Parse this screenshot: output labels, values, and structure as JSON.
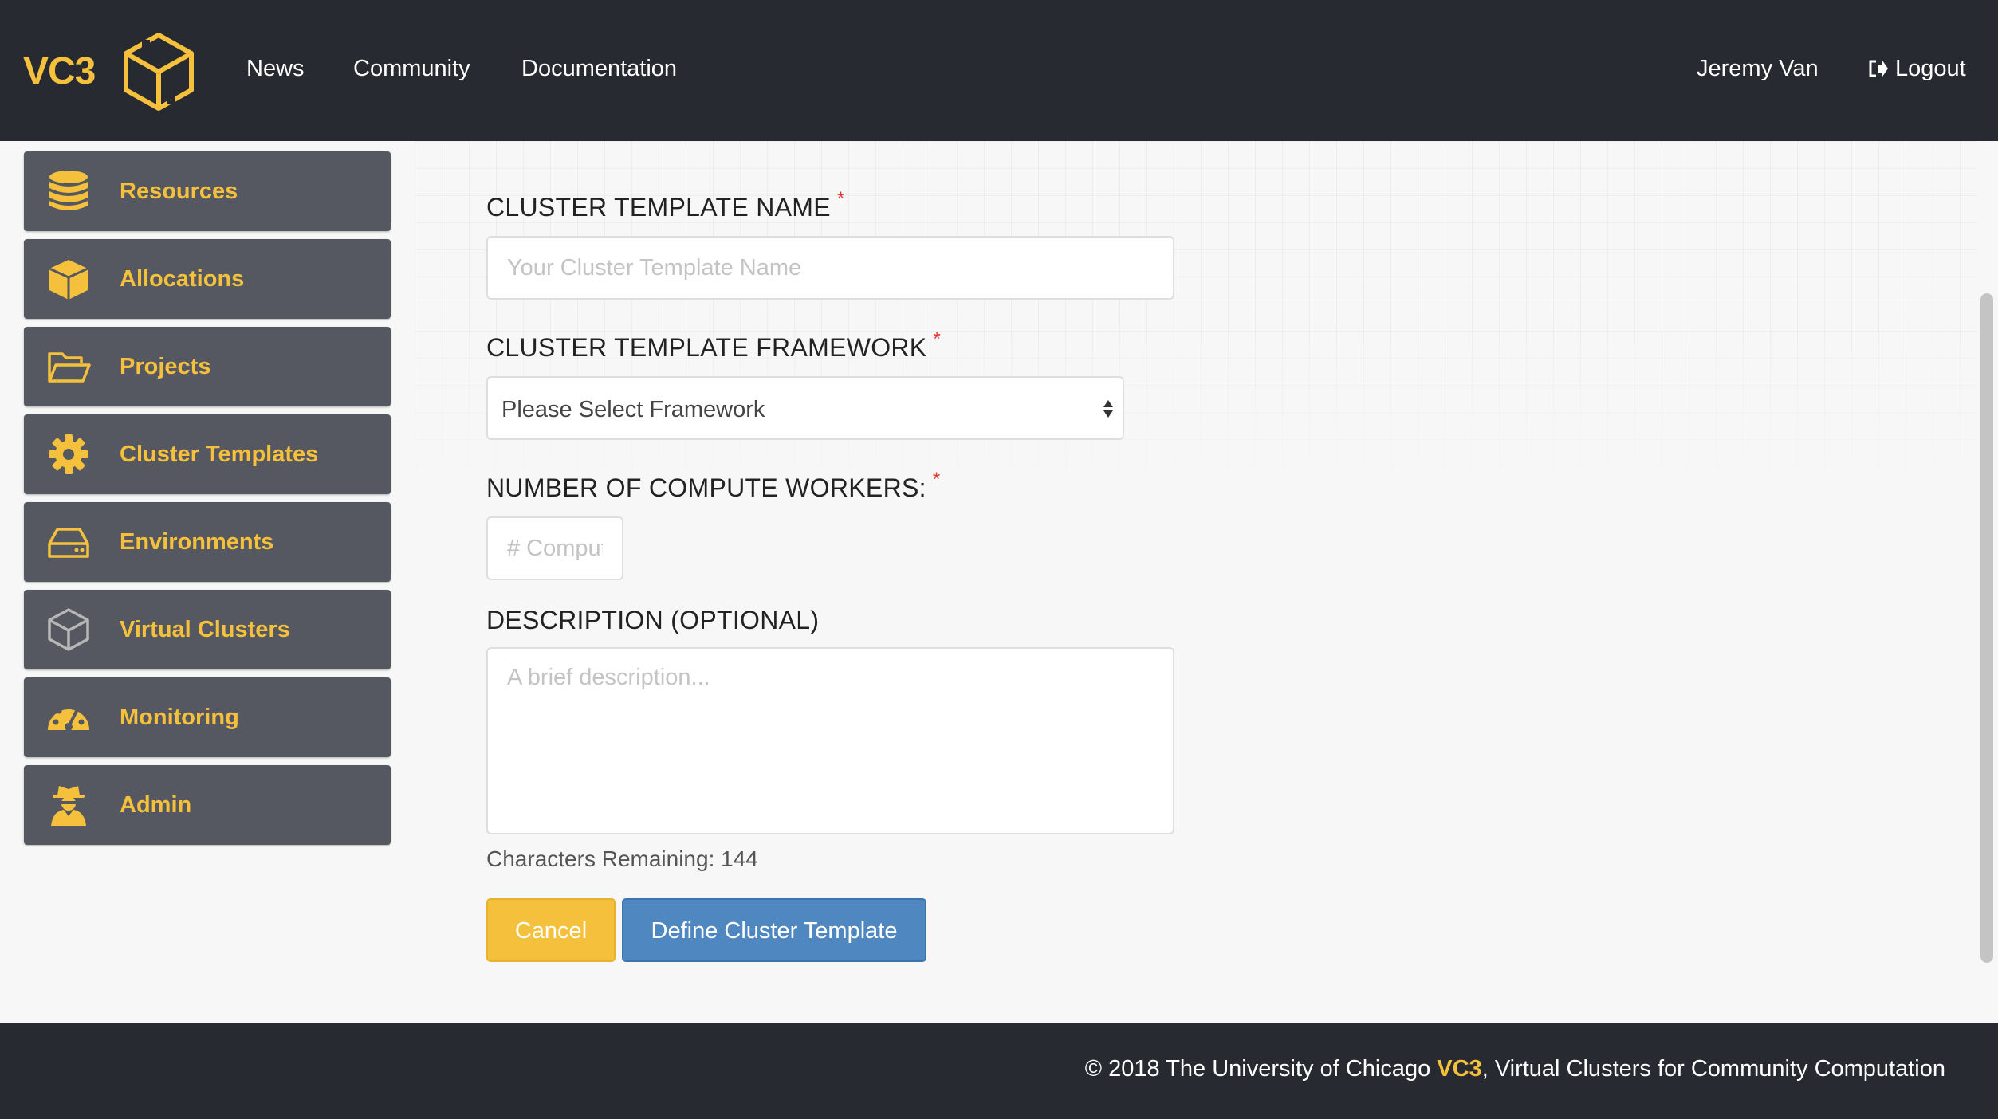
{
  "header": {
    "brand": "VC3",
    "nav": [
      "News",
      "Community",
      "Documentation"
    ],
    "user": "Jeremy Van",
    "logout_label": "Logout"
  },
  "sidebar": {
    "items": [
      {
        "label": "Resources",
        "icon": "database-icon"
      },
      {
        "label": "Allocations",
        "icon": "cube-icon"
      },
      {
        "label": "Projects",
        "icon": "folder-open-icon"
      },
      {
        "label": "Cluster Templates",
        "icon": "gear-icon"
      },
      {
        "label": "Environments",
        "icon": "hdd-icon"
      },
      {
        "label": "Virtual Clusters",
        "icon": "vc3-logo-icon"
      },
      {
        "label": "Monitoring",
        "icon": "dashboard-icon"
      },
      {
        "label": "Admin",
        "icon": "user-secret-icon"
      }
    ]
  },
  "form": {
    "name_label": "CLUSTER TEMPLATE NAME",
    "name_placeholder": "Your Cluster Template Name",
    "framework_label": "CLUSTER TEMPLATE FRAMEWORK",
    "framework_selected": "Please Select Framework",
    "workers_label": "NUMBER OF COMPUTE WORKERS:",
    "workers_placeholder": "# Compute Workers",
    "description_label": "DESCRIPTION (OPTIONAL)",
    "description_placeholder": "A brief description...",
    "required_mark": "*",
    "chars_remaining": "Characters Remaining: 144",
    "cancel_label": "Cancel",
    "submit_label": "Define Cluster Template"
  },
  "footer": {
    "prefix": "© 2018 The University of Chicago ",
    "brand": "VC3",
    "suffix": ", Virtual Clusters for Community Computation"
  },
  "colors": {
    "navbar": "#272a31",
    "accent": "#f5c13c",
    "sidebar_item": "#555860",
    "primary_button": "#4f87c0",
    "required": "#e3342f"
  }
}
